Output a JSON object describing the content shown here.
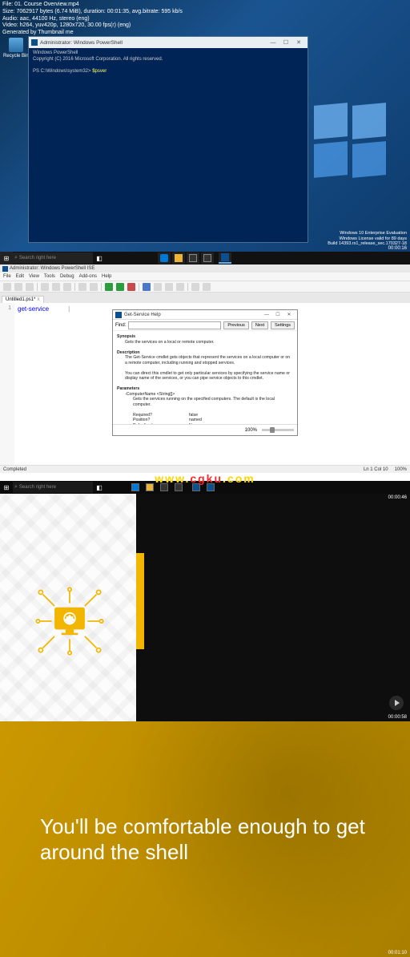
{
  "overlay": {
    "line1": "File: 01. Course Overview.mp4",
    "line2": "Size: 7062917 bytes (6.74 MiB), duration: 00:01:35, avg.bitrate: 595 kb/s",
    "line3": "Audio: aac, 44100 Hz, stereo (eng)",
    "line4": "Video: h264, yuv420p, 1280x720, 30.00 fps(r) (eng)",
    "line5": "Generated by Thumbnail me"
  },
  "desktop": {
    "recycle_label": "Recycle Bin",
    "eval_line1": "Windows 10 Enterprise Evaluation",
    "eval_line2": "Windows License valid for 89 days",
    "eval_line3": "Build 14393.rs1_release_sec.170327-18",
    "timecode": "00:00:16"
  },
  "pswin": {
    "title": "Administrator: Windows PowerShell",
    "line1": "Windows PowerShell",
    "line2": "Copyright (C) 2016 Microsoft Corporation. All rights reserved.",
    "prompt": "PS C:\\Windows\\system32>",
    "cmd": "$psver"
  },
  "taskbar1": {
    "search_placeholder": "Search right here"
  },
  "ise": {
    "title": "Administrator: Windows PowerShell ISE",
    "menu": {
      "file": "File",
      "edit": "Edit",
      "view": "View",
      "tools": "Tools",
      "debug": "Debug",
      "addons": "Add-ons",
      "help": "Help"
    },
    "tab": "Untitled1.ps1*",
    "tab_close": "X",
    "line_no": "1",
    "code": "get-service",
    "status_left": "Completed",
    "status_pos": "Ln 1  Col 10",
    "status_zoom": "100%"
  },
  "help": {
    "title": "Get-Service Help",
    "find_label": "Find:",
    "btn_prev": "Previous",
    "btn_next": "Next",
    "btn_settings": "Settings",
    "synopsis_h": "Synopsis",
    "synopsis_t": "Gets the services on a local or remote computer.",
    "desc_h": "Description",
    "desc_t1": "The Get-Service cmdlet gets objects that represent the services on a local computer or on a remote computer, including running and stopped services.",
    "desc_t2": "You can direct this cmdlet to get only particular services by specifying the service name or display name of the services, or you can pipe service objects to this cmdlet.",
    "params_h": "Parameters",
    "param_name": "-ComputerName <String[]>",
    "param_txt": "Gets the services running on the specified computers. The default is the local computer.",
    "col_req_l": "Required?",
    "col_req_v": "false",
    "col_pos_l": "Position?",
    "col_pos_v": "named",
    "col_def_l": "Default value",
    "col_def_v": "None",
    "zoom": "100%"
  },
  "watermark": {
    "a": "www.",
    "b": "cgku",
    "c": ".com"
  },
  "seg3": {
    "taskbar_search": "Search right here",
    "timecode_top": "00:00:46",
    "timecode_bot": "00:00:58"
  },
  "seg4": {
    "text": "You'll be comfortable enough to get around the shell",
    "timecode": "00:01:10"
  }
}
